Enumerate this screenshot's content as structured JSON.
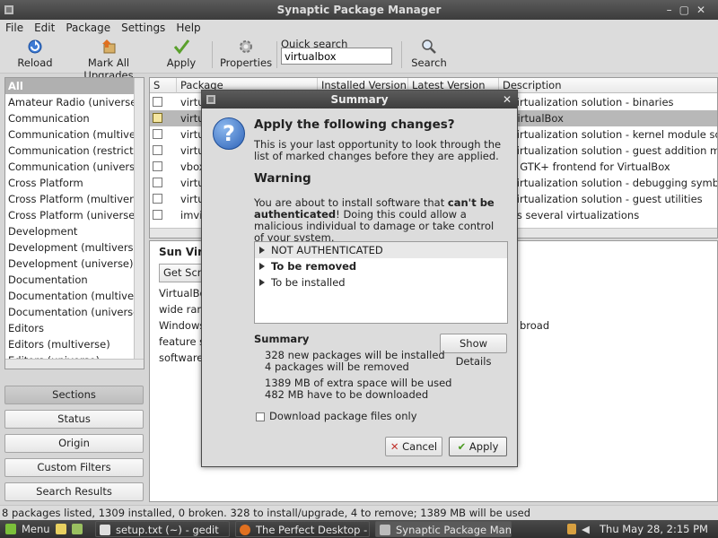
{
  "window": {
    "title": "Synaptic Package Manager"
  },
  "menu": [
    "File",
    "Edit",
    "Package",
    "Settings",
    "Help"
  ],
  "toolbar": {
    "reload": "Reload",
    "mark_all": "Mark All Upgrades",
    "apply": "Apply",
    "properties": "Properties",
    "quick_search_label": "Quick search",
    "quick_search_value": "virtualbox",
    "search": "Search"
  },
  "sections": [
    "All",
    "Amateur Radio (universe)",
    "Communication",
    "Communication (multiverse)",
    "Communication (restricted)",
    "Communication (universe)",
    "Cross Platform",
    "Cross Platform (multiverse)",
    "Cross Platform (universe)",
    "Development",
    "Development (multiverse)",
    "Development (universe)",
    "Documentation",
    "Documentation (multiverse)",
    "Documentation (universe)",
    "Editors",
    "Editors (multiverse)",
    "Editors (universe)"
  ],
  "side_buttons": [
    "Sections",
    "Status",
    "Origin",
    "Custom Filters",
    "Search Results"
  ],
  "table": {
    "headers": {
      "s": "S",
      "package": "Package",
      "installed": "Installed Version",
      "latest": "Latest Version",
      "description": "Description"
    },
    "rows": [
      {
        "pkg": "virtu",
        "desc": "5 virtualization solution - binaries"
      },
      {
        "pkg": "virtu",
        "desc": "n VirtualBox"
      },
      {
        "pkg": "virtu",
        "desc": "5 virtualization solution - kernel module sou"
      },
      {
        "pkg": "virtu",
        "desc": "5 virtualization solution - guest addition mo"
      },
      {
        "pkg": "vbox",
        "desc": "ple GTK+ frontend for VirtualBox"
      },
      {
        "pkg": "virtu",
        "desc": "5 virtualization solution - debugging symbo"
      },
      {
        "pkg": "virtu",
        "desc": "5 virtualization solution - guest utilities"
      },
      {
        "pkg": "imvi",
        "desc": "ects several virtualizations"
      }
    ]
  },
  "details": {
    "title": "Sun Virt",
    "button": "Get Screenshot",
    "lines": [
      "VirtualBo",
      "wide rang",
      "Windows,",
      "feature se",
      "software"
    ],
    "right_text": "broad"
  },
  "status_bar": "8 packages listed, 1309 installed, 0 broken. 328 to install/upgrade, 4 to remove; 1389 MB will be used",
  "panel": {
    "menu": "Menu",
    "tasks": [
      "setup.txt (~) - gedit",
      "The Perfect Desktop - ...",
      "Synaptic Package Man..."
    ],
    "clock": "Thu May 28,  2:15 PM"
  },
  "dialog": {
    "title": "Summary",
    "heading": "Apply the following changes?",
    "intro": "This is your last opportunity to look through the list of marked changes before they are applied.",
    "warning_heading": "Warning",
    "warning_pre": "You are about to install software that ",
    "warning_bold": "can't be authenticated",
    "warning_post": "! Doing this could allow a malicious individual to damage or take control of your system.",
    "tree": [
      "NOT AUTHENTICATED",
      "To be removed",
      "To be installed"
    ],
    "summary_heading": "Summary",
    "show_details": "Show Details",
    "summary_lines": [
      "328 new packages will be installed",
      "4 packages will be removed",
      "1389 MB of extra space will be used",
      "482 MB have to be downloaded"
    ],
    "download_only": "Download package files only",
    "cancel": "Cancel",
    "apply": "Apply"
  }
}
